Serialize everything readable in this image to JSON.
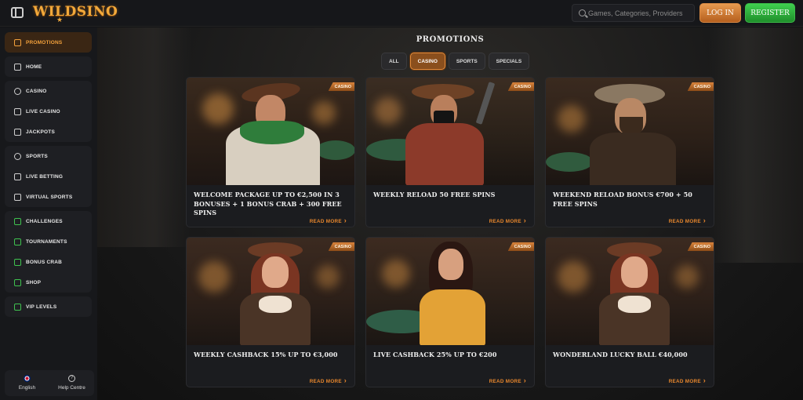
{
  "header": {
    "logo_text": "WILDSINO",
    "logo_star": "★",
    "search_placeholder": "Games, Categories, Providers",
    "login_label": "LOG IN",
    "register_label": "REGISTER"
  },
  "sidebar": {
    "groups": [
      [
        {
          "label": "PROMOTIONS",
          "icon": "gift-icon",
          "active": true
        }
      ],
      [
        {
          "label": "HOME",
          "icon": "home-icon"
        }
      ],
      [
        {
          "label": "CASINO",
          "icon": "casino-chip-icon"
        },
        {
          "label": "LIVE CASINO",
          "icon": "live-casino-icon"
        },
        {
          "label": "JACKPOTS",
          "icon": "jackpot-icon"
        }
      ],
      [
        {
          "label": "SPORTS",
          "icon": "ball-icon"
        },
        {
          "label": "LIVE BETTING",
          "icon": "live-betting-icon"
        },
        {
          "label": "VIRTUAL SPORTS",
          "icon": "virtual-sports-icon"
        }
      ],
      [
        {
          "label": "CHALLENGES",
          "icon": "challenges-icon"
        },
        {
          "label": "TOURNAMENTS",
          "icon": "trophy-icon"
        },
        {
          "label": "BONUS CRAB",
          "icon": "bonus-crab-icon"
        },
        {
          "label": "SHOP",
          "icon": "shop-icon"
        }
      ],
      [
        {
          "label": "VIP LEVELS",
          "icon": "vip-icon"
        }
      ]
    ],
    "language_label": "English",
    "help_label": "Help Centre",
    "help_symbol": "?"
  },
  "main": {
    "title": "PROMOTIONS",
    "tabs": [
      {
        "label": "ALL",
        "active": false
      },
      {
        "label": "CASINO",
        "active": true
      },
      {
        "label": "SPORTS",
        "active": false
      },
      {
        "label": "SPECIALS",
        "active": false
      }
    ],
    "cards": [
      {
        "badge": "CASINO",
        "title": "WELCOME PACKAGE UP TO €2,500 IN 3 BONUSES + 1 BONUS CRAB + 300 FREE SPINS",
        "cta": "READ MORE"
      },
      {
        "badge": "CASINO",
        "title": "WEEKLY RELOAD 50 FREE SPINS",
        "cta": "READ MORE"
      },
      {
        "badge": "CASINO",
        "title": "WEEKEND RELOAD BONUS €700 + 50 FREE SPINS",
        "cta": "READ MORE"
      },
      {
        "badge": "CASINO",
        "title": "WEEKLY CASHBACK 15% UP TO €3,000",
        "cta": "READ MORE"
      },
      {
        "badge": "CASINO",
        "title": "LIVE CASHBACK 25% UP TO €200",
        "cta": "READ MORE"
      },
      {
        "badge": "CASINO",
        "title": "WONDERLAND LUCKY BALL €40,000",
        "cta": "READ MORE"
      }
    ]
  },
  "colors": {
    "accent_orange": "#e8872d",
    "register_green": "#2fb13d",
    "background": "#121315"
  }
}
